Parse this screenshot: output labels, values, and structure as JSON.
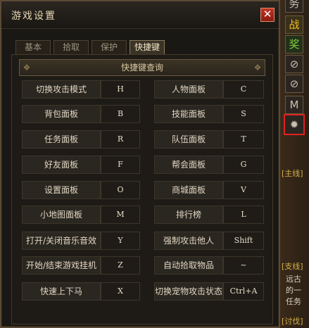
{
  "window": {
    "title": "游戏设置",
    "close_glyph": "✕"
  },
  "tabs": [
    {
      "label": "基本",
      "active": false
    },
    {
      "label": "拾取",
      "active": false
    },
    {
      "label": "保护",
      "active": false
    },
    {
      "label": "快捷键",
      "active": true
    }
  ],
  "panel": {
    "header": "快捷键查询"
  },
  "shortcuts": [
    {
      "left_label": "切换攻击模式",
      "left_key": "H",
      "right_label": "人物面板",
      "right_key": "C"
    },
    {
      "left_label": "背包面板",
      "left_key": "B",
      "right_label": "技能面板",
      "right_key": "S"
    },
    {
      "left_label": "任务面板",
      "left_key": "R",
      "right_label": "队伍面板",
      "right_key": "T"
    },
    {
      "left_label": "好友面板",
      "left_key": "F",
      "right_label": "帮会面板",
      "right_key": "G"
    },
    {
      "left_label": "设置面板",
      "left_key": "O",
      "right_label": "商城面板",
      "right_key": "V"
    },
    {
      "left_label": "小地图面板",
      "left_key": "M",
      "right_label": "排行榜",
      "right_key": "L"
    },
    {
      "left_label": "打开/关闭音乐音效",
      "left_key": "Y",
      "right_label": "强制攻击他人",
      "right_key": "Shift"
    },
    {
      "left_label": "开始/结束游戏挂机",
      "left_key": "Z",
      "right_label": "自动拾取物品",
      "right_key": "~"
    },
    {
      "left_label": "快速上下马",
      "left_key": "X",
      "right_label": "切换宠物攻击状态",
      "right_key": "Ctrl+A"
    }
  ],
  "side_strip": {
    "icons": [
      {
        "name": "activity-icon",
        "glyph": "务"
      },
      {
        "name": "battle-icon",
        "glyph": "战"
      },
      {
        "name": "reward-icon",
        "glyph": "奖"
      },
      {
        "name": "disabled-icon-1",
        "glyph": "⊘"
      },
      {
        "name": "disabled-icon-2",
        "glyph": "⊘"
      },
      {
        "name": "mail-icon",
        "glyph": "M"
      },
      {
        "name": "settings-gear-icon",
        "glyph": "✹"
      }
    ],
    "texts": [
      "[主线]",
      "[支线]",
      "远古",
      "的一",
      "任务",
      "[讨伐]"
    ]
  }
}
